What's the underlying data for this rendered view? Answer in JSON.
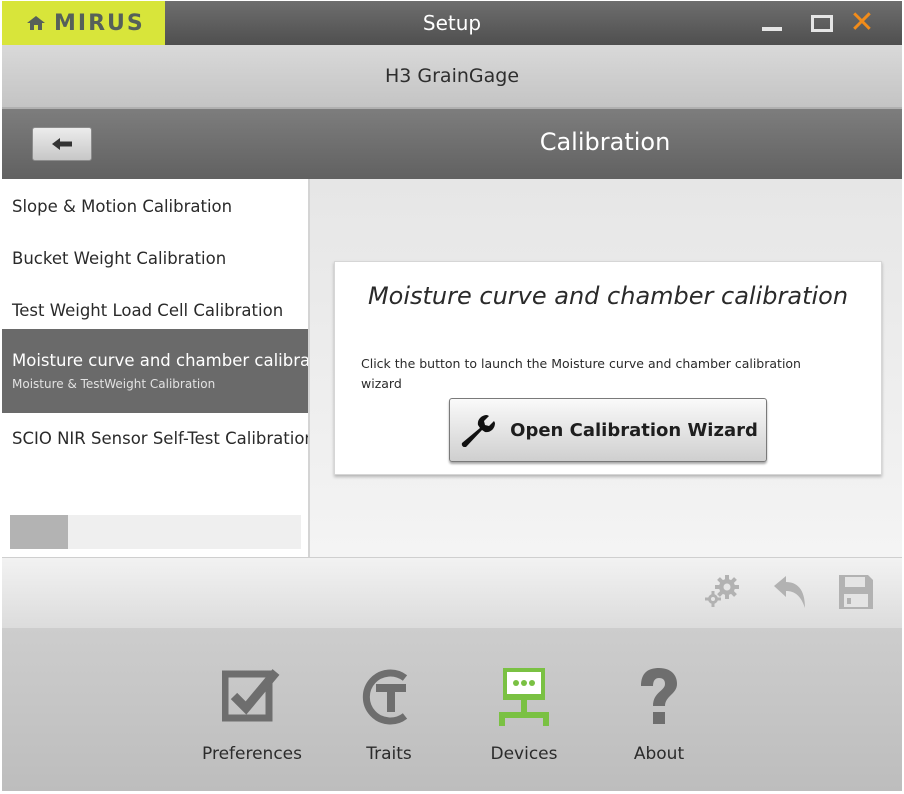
{
  "window": {
    "logo_text": "MIRUS",
    "title": "Setup",
    "close_glyph": "✕"
  },
  "device": {
    "name": "H3 GrainGage"
  },
  "page": {
    "title": "Calibration",
    "back_icon": "left-arrow-icon"
  },
  "sidebar": {
    "items": [
      {
        "label": "Slope & Motion Calibration"
      },
      {
        "label": "Bucket Weight Calibration"
      },
      {
        "label": "Test Weight Load Cell Calibration"
      },
      {
        "label": "Moisture curve and chamber calibration",
        "sublabel": "Moisture & TestWeight Calibration",
        "selected": true
      },
      {
        "label": "SCIO NIR Sensor Self-Test Calibration"
      }
    ],
    "scroll_position": 0.0
  },
  "card": {
    "title": "Moisture curve and chamber calibration",
    "description": "Click the button to launch the Moisture curve and chamber calibration wizard",
    "button_label": "Open Calibration Wizard",
    "button_icon": "wrench-icon"
  },
  "actions": [
    {
      "name": "settings",
      "icon": "gears-icon"
    },
    {
      "name": "undo",
      "icon": "undo-arrow-icon"
    },
    {
      "name": "save",
      "icon": "floppy-disk-icon"
    }
  ],
  "nav": {
    "items": [
      {
        "label": "Preferences",
        "icon": "checkbox-icon",
        "active": false
      },
      {
        "label": "Traits",
        "icon": "traits-t-icon",
        "active": false
      },
      {
        "label": "Devices",
        "icon": "monitor-network-icon",
        "active": true
      },
      {
        "label": "About",
        "icon": "question-mark-icon",
        "active": false
      }
    ]
  },
  "colors": {
    "logo_bg": "#d8e53a",
    "close_accent": "#f28c1a",
    "nav_active": "#7ac143",
    "selected_item": "#6a6a6a"
  }
}
